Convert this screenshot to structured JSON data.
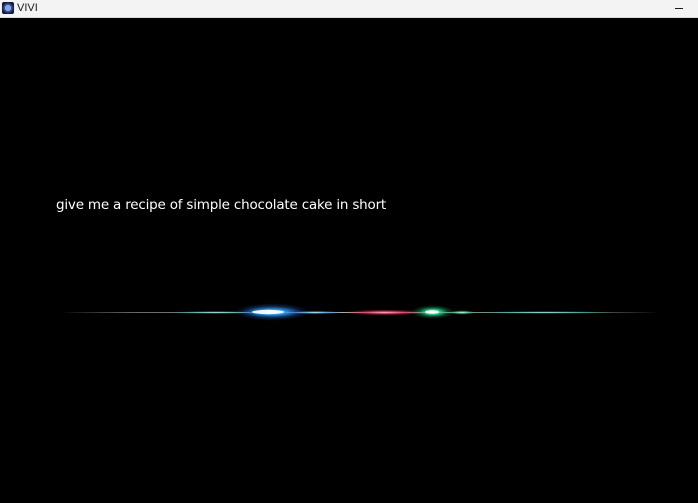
{
  "window": {
    "title": "VIVI",
    "app_icon": "vivi-app-icon",
    "minimize_icon": "minimize-icon"
  },
  "assistant": {
    "query_text": "give me a recipe of simple chocolate cake in short",
    "waveform_state": "listening"
  },
  "colors": {
    "background": "#000000",
    "titlebar": "#f3f3f3",
    "wave_blue": "#2a9bff",
    "wave_red": "#ff3b6b",
    "wave_green": "#39e59a",
    "wave_cyan": "#4fe0d6"
  }
}
